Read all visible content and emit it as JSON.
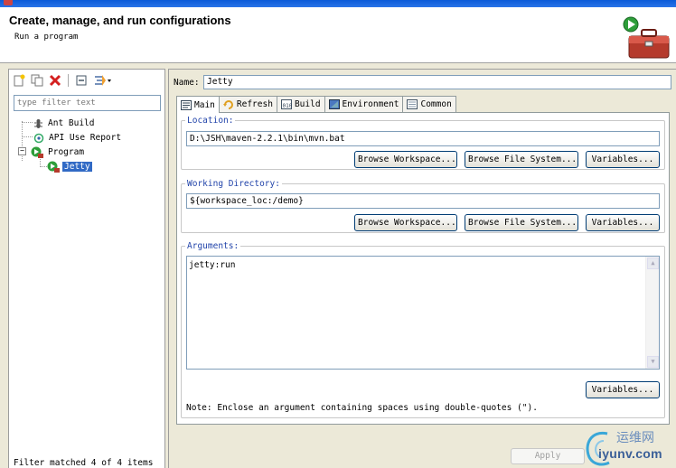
{
  "header": {
    "title": "Create, manage, and run configurations",
    "subtitle": "Run a program"
  },
  "left_panel": {
    "filter_placeholder": "type filter text",
    "tree": [
      {
        "label": "Ant Build",
        "icon": "ant-icon"
      },
      {
        "label": "API Use Report",
        "icon": "api-report-icon"
      },
      {
        "label": "Program",
        "icon": "program-icon",
        "expanded": true
      },
      {
        "label": "Jetty",
        "icon": "program-config-icon",
        "selected": true
      }
    ],
    "status": "Filter matched 4 of 4 items"
  },
  "config": {
    "name_label": "Name:",
    "name_value": "Jetty",
    "tabs": [
      {
        "label": "Main",
        "icon": "main-tab-icon",
        "active": true
      },
      {
        "label": "Refresh",
        "icon": "refresh-icon"
      },
      {
        "label": "Build",
        "icon": "build-icon"
      },
      {
        "label": "Environment",
        "icon": "environment-icon"
      },
      {
        "label": "Common",
        "icon": "common-icon"
      }
    ],
    "location": {
      "label": "Location:",
      "value": "D:\\JSH\\maven-2.2.1\\bin\\mvn.bat",
      "browse_workspace": "Browse Workspace...",
      "browse_fs": "Browse File System...",
      "variables": "Variables..."
    },
    "working_dir": {
      "label": "Working Directory:",
      "value": "${workspace_loc:/demo}",
      "browse_workspace": "Browse Workspace...",
      "browse_fs": "Browse File System...",
      "variables": "Variables..."
    },
    "arguments": {
      "label": "Arguments:",
      "value": "jetty:run",
      "variables": "Variables..."
    },
    "note": "Note: Enclose an argument containing spaces using double-quotes (\")."
  },
  "footer": {
    "apply": "Apply"
  },
  "watermark": {
    "cn": "运维网",
    "en": "iyunv.com"
  }
}
